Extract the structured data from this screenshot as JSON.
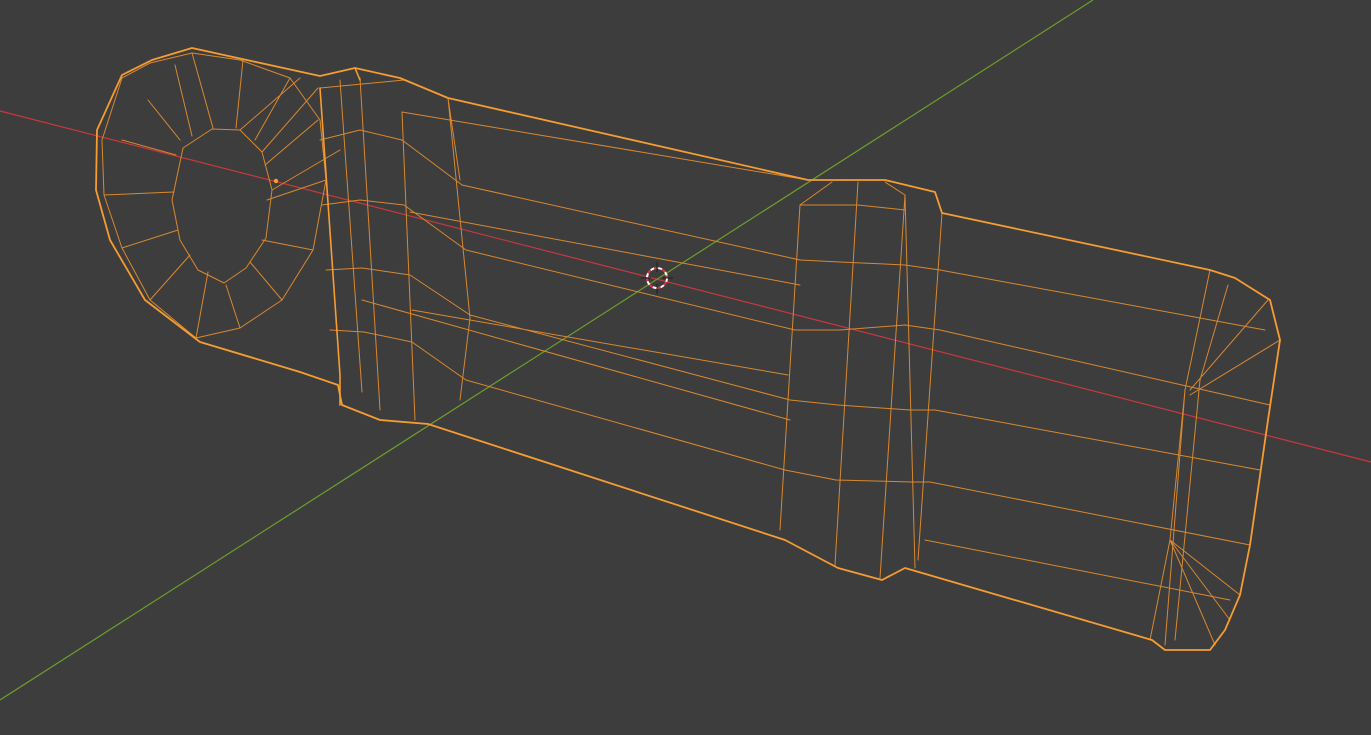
{
  "viewport": {
    "mode": "wireframe",
    "view": "perspective",
    "background_color": "#3d3d3d"
  },
  "axes": {
    "x_axis_color": "#c8383f",
    "y_axis_color": "#6e9e2a"
  },
  "selection": {
    "object_state": "selected",
    "outline_color": "#f59c32",
    "inner_edge_color": "#d9882f"
  },
  "cursor": {
    "icon": "3d-cursor-icon",
    "ring_colors": [
      "#ffffff",
      "#d9334a"
    ]
  },
  "origin": {
    "icon": "object-origin-dot-icon",
    "color": "#f59c32"
  }
}
